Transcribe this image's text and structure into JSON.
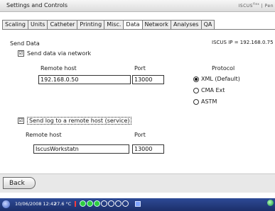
{
  "window": {
    "title": "Settings and Controls",
    "brand": "ISCUS",
    "brand_sup": "flex",
    "brand_suffix": "| Pen"
  },
  "tabs": [
    {
      "label": "Scaling",
      "active": false
    },
    {
      "label": "Units",
      "active": false
    },
    {
      "label": "Catheter",
      "active": false
    },
    {
      "label": "Printing",
      "active": false
    },
    {
      "label": "Misc.",
      "active": false
    },
    {
      "label": "Data",
      "active": true
    },
    {
      "label": "Network",
      "active": false
    },
    {
      "label": "Analyses",
      "active": false
    },
    {
      "label": "QA",
      "active": false
    }
  ],
  "send_data": {
    "heading": "Send Data",
    "iscus_ip": "ISCUS IP = 192.168.0.75",
    "send_via_network": {
      "label": "Send data via network",
      "checked": true
    },
    "remote_host_label": "Remote host",
    "port_label": "Port",
    "protocol_label": "Protocol",
    "remote_host_value": "192.168.0.50",
    "port_value": "13000",
    "protocols": [
      {
        "label": "XML (Default)",
        "selected": true
      },
      {
        "label": "CMA Ext",
        "selected": false
      },
      {
        "label": "ASTM",
        "selected": false
      }
    ]
  },
  "send_log": {
    "checkbox": {
      "label": "Send log to a remote host (service)",
      "checked": true
    },
    "remote_host_label": "Remote host",
    "port_label": "Port",
    "remote_host_value": "IscusWorkstatn",
    "port_value": "13000"
  },
  "footer": {
    "back_label": "Back"
  },
  "taskbar": {
    "datetime": "10/06/2008 12:42",
    "temperature": "27.6 °C",
    "icons": [
      "start-orb-icon",
      "warning-icon",
      "status-dots-icon",
      "network-icon",
      "green-orb-icon"
    ]
  },
  "colors": {
    "taskbar": "#1c2f6a",
    "status_on": "#2ecc40"
  }
}
